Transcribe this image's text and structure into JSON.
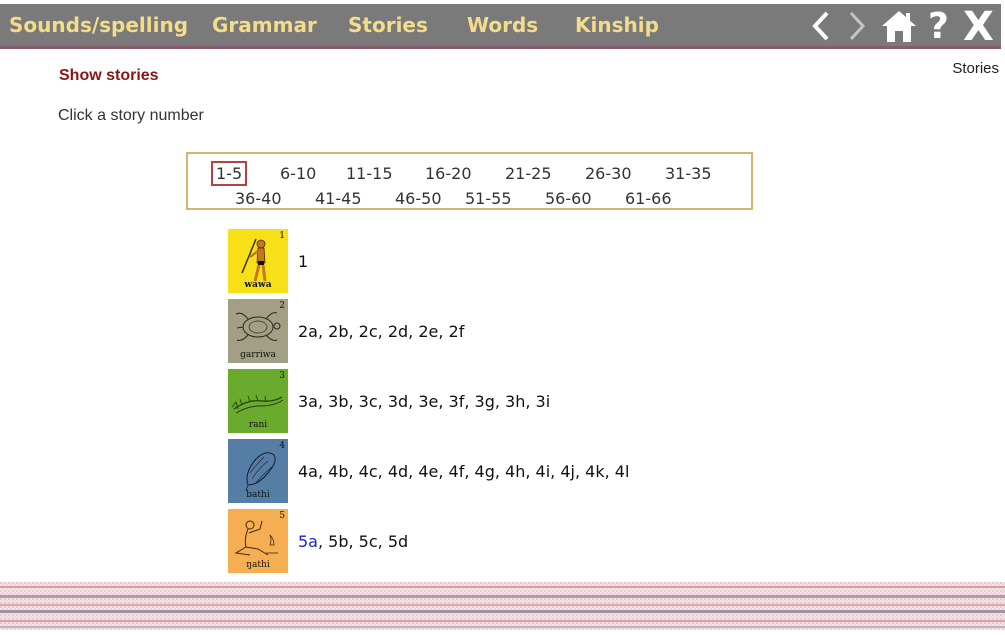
{
  "nav": {
    "items": [
      "Sounds/spelling",
      "Grammar",
      "Stories",
      "Words",
      "Kinship"
    ],
    "icons": [
      "chevron-left-icon",
      "chevron-right-icon",
      "home-icon",
      "help-icon",
      "close-icon"
    ],
    "help_label": "?",
    "close_label": "X",
    "bar_color": "#7a7a7a",
    "text_color": "#f3dc8a"
  },
  "section_name": "Stories",
  "page_title": "Show stories",
  "instruction": "Click a story number",
  "ranges": {
    "row1": [
      "1-5",
      "6-10",
      "11-15",
      "16-20",
      "21-25",
      "26-30",
      "31-35"
    ],
    "row2": [
      "36-40",
      "41-45",
      "46-50",
      "51-55",
      "56-60",
      "61-66"
    ],
    "selected": "1-5"
  },
  "stories": [
    {
      "num": "1",
      "label": "wawa",
      "parts": [
        "1"
      ],
      "active": "",
      "color": "#f7e018"
    },
    {
      "num": "2",
      "label": "garriwa",
      "parts": [
        "2a",
        "2b",
        "2c",
        "2d",
        "2e",
        "2f"
      ],
      "active": "",
      "color": "#a29f84"
    },
    {
      "num": "3",
      "label": "rani",
      "parts": [
        "3a",
        "3b",
        "3c",
        "3d",
        "3e",
        "3f",
        "3g",
        "3h",
        "3i"
      ],
      "active": "",
      "color": "#6aab2d"
    },
    {
      "num": "4",
      "label": "bathi",
      "parts": [
        "4a",
        "4b",
        "4c",
        "4d",
        "4e",
        "4f",
        "4g",
        "4h",
        "4i",
        "4j",
        "4k",
        "4l"
      ],
      "active": "",
      "color": "#557ea6"
    },
    {
      "num": "5",
      "label": "ŋathi",
      "parts": [
        "5a",
        "5b",
        "5c",
        "5d"
      ],
      "active": "5a",
      "color": "#f6ae52"
    }
  ]
}
